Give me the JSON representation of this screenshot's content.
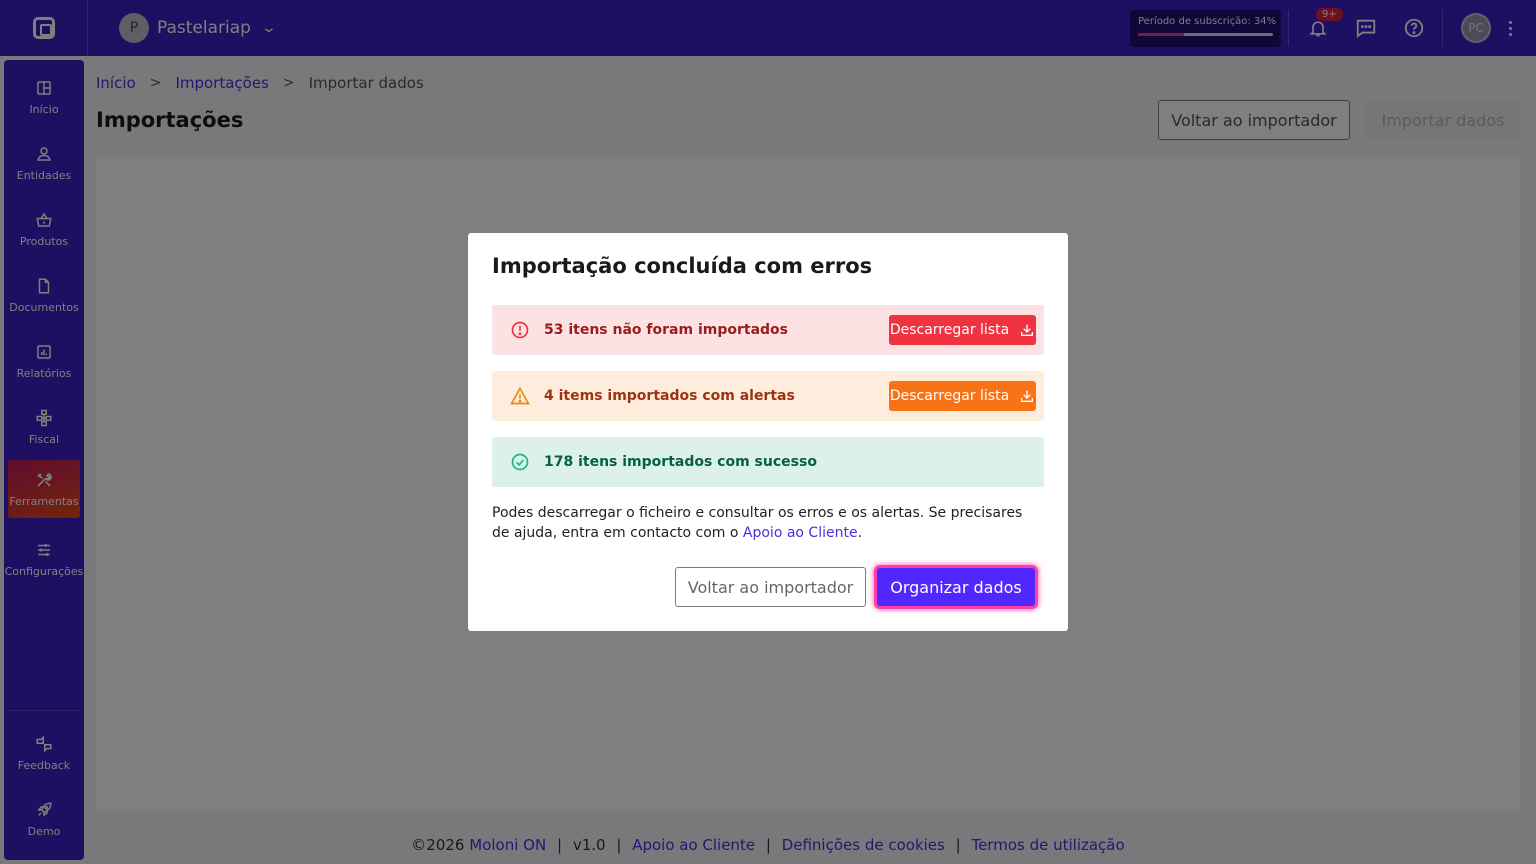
{
  "topbar": {
    "company_initial": "P",
    "company_name": "Pastelariap",
    "subscription_label": "Período de subscrição: 34%",
    "subscription_progress": 0.34,
    "notifications_badge": "9+",
    "user_initials": "PC",
    "icons": [
      "logo-icon",
      "chevron-down-icon",
      "bell-icon",
      "chat-icon",
      "help-icon",
      "kebab-icon"
    ]
  },
  "sidebar": {
    "items": [
      {
        "label": "Início",
        "icon": "grid-icon"
      },
      {
        "label": "Entidades",
        "icon": "user-icon"
      },
      {
        "label": "Produtos",
        "icon": "basket-icon"
      },
      {
        "label": "Documentos",
        "icon": "document-icon"
      },
      {
        "label": "Relatórios",
        "icon": "chart-icon"
      },
      {
        "label": "Fiscal",
        "icon": "hierarchy-icon"
      },
      {
        "label": "Ferramentas",
        "icon": "tools-icon"
      },
      {
        "label": "Configurações",
        "icon": "sliders-icon"
      }
    ],
    "bottom_items": [
      {
        "label": "Feedback",
        "icon": "feedback-icon"
      },
      {
        "label": "Demo",
        "icon": "rocket-icon"
      }
    ],
    "active_index": 6
  },
  "breadcrumb": {
    "items": [
      "Início",
      "Importações"
    ],
    "current": "Importar dados"
  },
  "page": {
    "title": "Importações",
    "back_button": "Voltar ao importador",
    "import_button": "Importar dados"
  },
  "footer": {
    "copyright": "©2026",
    "brand": "Moloni ON",
    "version": "v1.0",
    "links": [
      "Apoio ao Cliente",
      "Definições de cookies",
      "Termos de utilização"
    ]
  },
  "modal": {
    "title": "Importação concluída com erros",
    "error_text": "53 itens não foram importados",
    "warning_text": "4 items importados com alertas",
    "success_text": "178 itens importados com sucesso",
    "download_label": "Descarregar lista",
    "info_text_before": "Podes descarregar o ficheiro e consultar os erros e os alertas. Se precisares de ajuda, entra em contacto com o ",
    "info_link": "Apoio ao Cliente",
    "info_text_after": ".",
    "back_button": "Voltar ao importador",
    "primary_button": "Organizar dados",
    "colors": {
      "error": "#ef3340",
      "warning": "#f97316",
      "success": "#10b981",
      "primary": "#5227ff"
    }
  }
}
